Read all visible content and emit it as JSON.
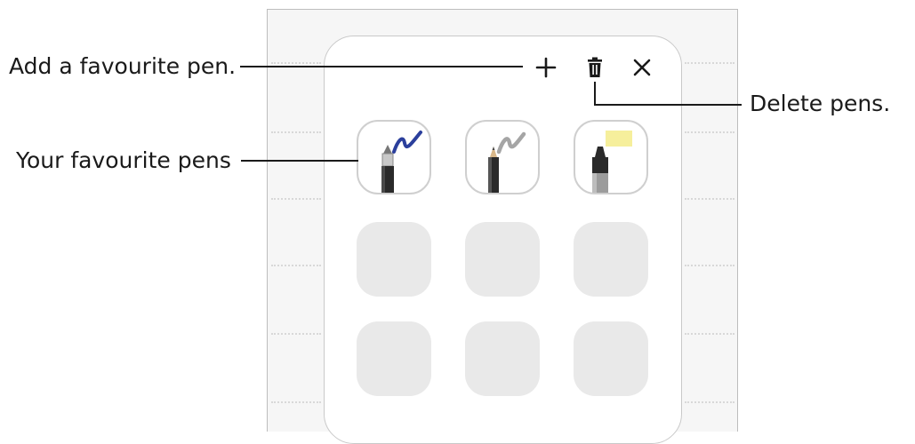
{
  "callouts": {
    "add_pen": "Add a favourite pen.",
    "favourite_pens": "Your favourite pens",
    "delete_pens": "Delete pens."
  },
  "toolbar": {
    "add_icon": "plus-icon",
    "delete_icon": "trash-icon",
    "close_icon": "close-icon"
  },
  "pens": [
    {
      "name": "fountain-pen",
      "stroke_color": "#2b3f9c"
    },
    {
      "name": "pencil",
      "stroke_color": "#9a9a9a"
    },
    {
      "name": "highlighter",
      "stroke_color": "#f6ef9c"
    }
  ],
  "empty_slots": 6,
  "colors": {
    "text": "#1a1a1a",
    "panel_border": "#c9c9c9",
    "empty_slot": "#e9e9e9"
  }
}
